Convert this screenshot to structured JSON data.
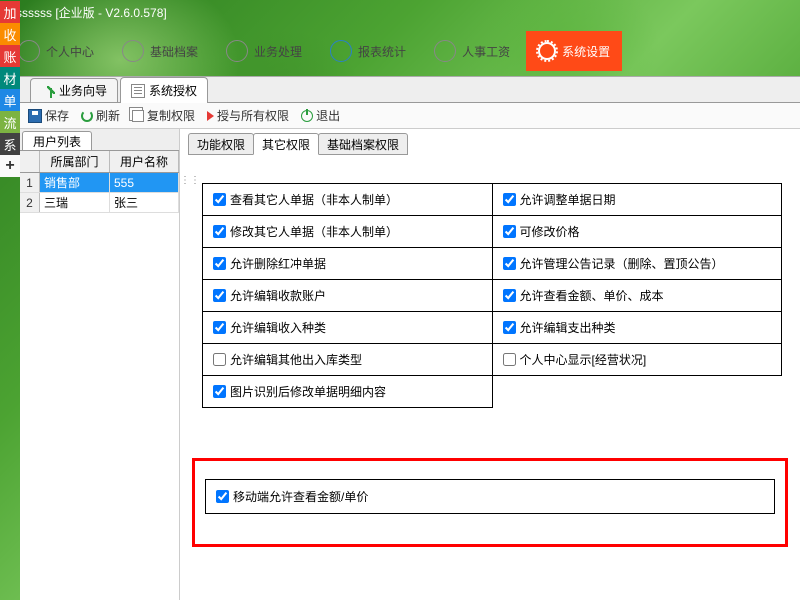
{
  "title": "sssssss  [企业版 - V2.6.0.578]",
  "topnav": {
    "items": [
      {
        "label": "个人中心"
      },
      {
        "label": "基础档案"
      },
      {
        "label": "业务处理"
      },
      {
        "label": "报表统计"
      },
      {
        "label": "人事工资"
      },
      {
        "label": "系统设置"
      }
    ]
  },
  "sidetabs": [
    "加",
    "收",
    "账",
    "材",
    "单",
    "流",
    "系",
    "+"
  ],
  "doctabs": {
    "items": [
      {
        "label": "业务向导"
      },
      {
        "label": "系统授权"
      }
    ],
    "active": 1
  },
  "toolbar": {
    "save": "保存",
    "refresh": "刷新",
    "copy": "复制权限",
    "grant": "授与所有权限",
    "exit": "退出"
  },
  "leftpane": {
    "tab": "用户列表",
    "headers": {
      "dept": "所属部门",
      "user": "用户名称"
    },
    "rows": [
      {
        "n": "1",
        "dept": "销售部",
        "user": "555"
      },
      {
        "n": "2",
        "dept": "三瑞",
        "user": "张三"
      }
    ],
    "selected": 0
  },
  "rtabs": {
    "items": [
      "功能权限",
      "其它权限",
      "基础档案权限"
    ],
    "active": 1
  },
  "perms": {
    "r0c0": "查看其它人单据（非本人制单）",
    "r0c1": "允许调整单据日期",
    "r1c0": "修改其它人单据（非本人制单）",
    "r1c1": "可修改价格",
    "r2c0": "允许删除红冲单据",
    "r2c1": "允许管理公告记录（删除、置顶公告）",
    "r3c0": "允许编辑收款账户",
    "r3c1": "允许查看金额、单价、成本",
    "r4c0": "允许编辑收入种类",
    "r4c1": "允许编辑支出种类",
    "r5c0": "允许编辑其他出入库类型",
    "r5c1": "个人中心显示[经营状况]",
    "r6c0": "图片识别后修改单据明细内容"
  },
  "checks": {
    "r0c0": true,
    "r0c1": true,
    "r1c0": true,
    "r1c1": true,
    "r2c0": true,
    "r2c1": true,
    "r3c0": true,
    "r3c1": true,
    "r4c0": true,
    "r4c1": true,
    "r5c0": false,
    "r5c1": false,
    "r6c0": true,
    "mobile": true
  },
  "mobile_label": "移动端允许查看金额/单价"
}
